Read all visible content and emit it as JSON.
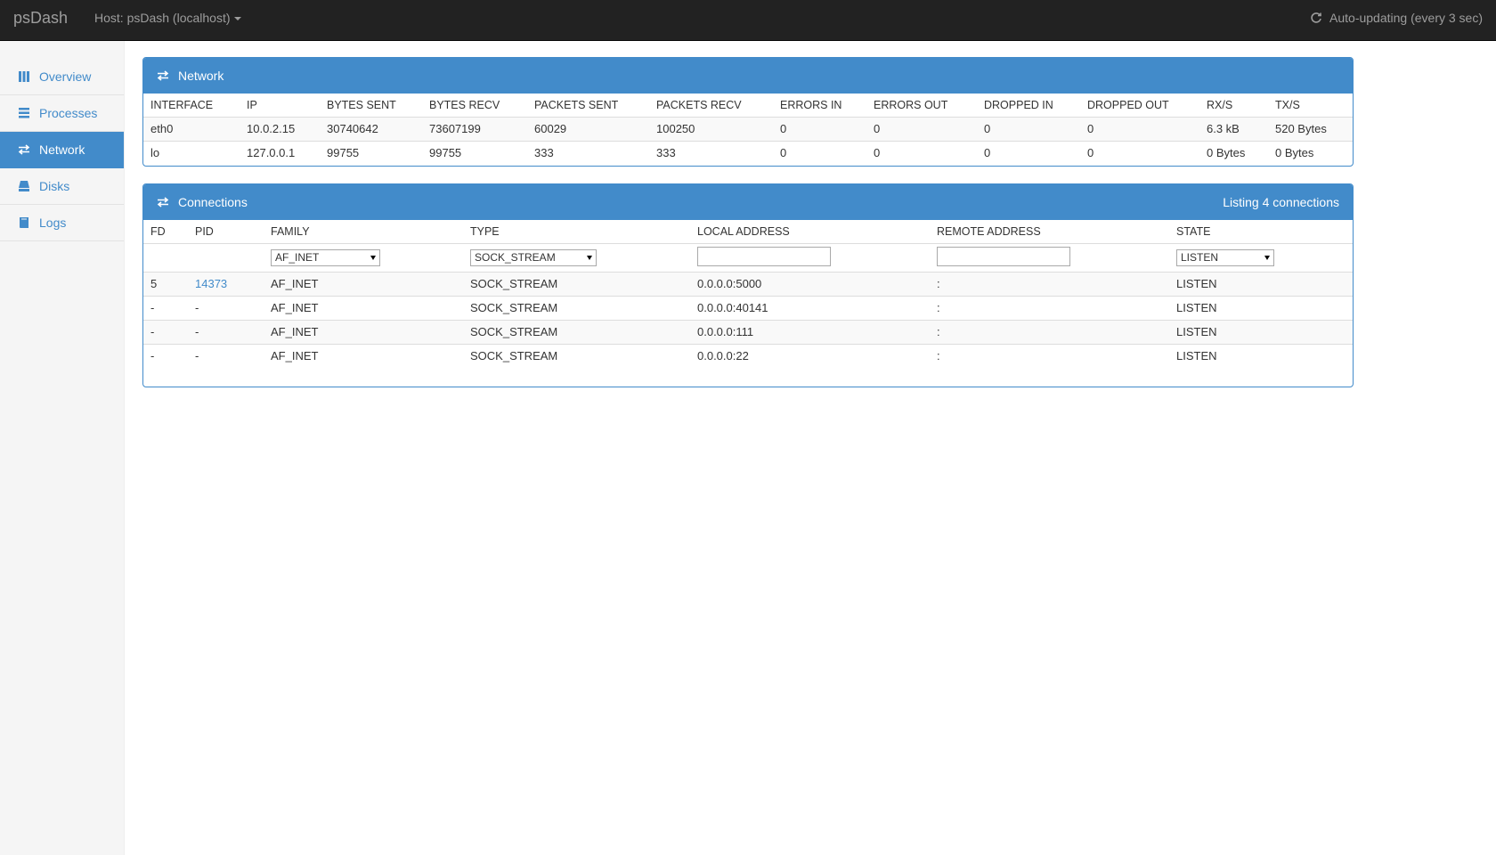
{
  "navbar": {
    "brand": "psDash",
    "host": "Host: psDash (localhost)",
    "auto_updating": "Auto-updating (every 3 sec)"
  },
  "sidebar": {
    "items": [
      {
        "label": "Overview",
        "icon": "grid-icon",
        "active": false
      },
      {
        "label": "Processes",
        "icon": "list-icon",
        "active": false
      },
      {
        "label": "Network",
        "icon": "transfer-icon",
        "active": true
      },
      {
        "label": "Disks",
        "icon": "hdd-icon",
        "active": false
      },
      {
        "label": "Logs",
        "icon": "book-icon",
        "active": false
      }
    ]
  },
  "network_panel": {
    "title": "Network",
    "columns": [
      "INTERFACE",
      "IP",
      "BYTES SENT",
      "BYTES RECV",
      "PACKETS SENT",
      "PACKETS RECV",
      "ERRORS IN",
      "ERRORS OUT",
      "DROPPED IN",
      "DROPPED OUT",
      "RX/S",
      "TX/S"
    ],
    "rows": [
      [
        "eth0",
        "10.0.2.15",
        "30740642",
        "73607199",
        "60029",
        "100250",
        "0",
        "0",
        "0",
        "0",
        "6.3 kB",
        "520 Bytes"
      ],
      [
        "lo",
        "127.0.0.1",
        "99755",
        "99755",
        "333",
        "333",
        "0",
        "0",
        "0",
        "0",
        "0 Bytes",
        "0 Bytes"
      ]
    ]
  },
  "connections_panel": {
    "title": "Connections",
    "count_text": "Listing 4 connections",
    "columns": [
      "FD",
      "PID",
      "FAMILY",
      "TYPE",
      "LOCAL ADDRESS",
      "REMOTE ADDRESS",
      "STATE"
    ],
    "filters": {
      "family": "AF_INET",
      "type": "SOCK_STREAM",
      "local_address": "",
      "remote_address": "",
      "state": "LISTEN"
    },
    "rows": [
      {
        "fd": "5",
        "pid": "14373",
        "family": "AF_INET",
        "type": "SOCK_STREAM",
        "local": "0.0.0.0:5000",
        "remote": ":",
        "state": "LISTEN"
      },
      {
        "fd": "-",
        "pid": "-",
        "family": "AF_INET",
        "type": "SOCK_STREAM",
        "local": "0.0.0.0:40141",
        "remote": ":",
        "state": "LISTEN"
      },
      {
        "fd": "-",
        "pid": "-",
        "family": "AF_INET",
        "type": "SOCK_STREAM",
        "local": "0.0.0.0:111",
        "remote": ":",
        "state": "LISTEN"
      },
      {
        "fd": "-",
        "pid": "-",
        "family": "AF_INET",
        "type": "SOCK_STREAM",
        "local": "0.0.0.0:22",
        "remote": ":",
        "state": "LISTEN"
      }
    ]
  },
  "colors": {
    "navbar_bg": "#222222",
    "accent": "#428bca",
    "sidebar_bg": "#f5f5f5"
  }
}
